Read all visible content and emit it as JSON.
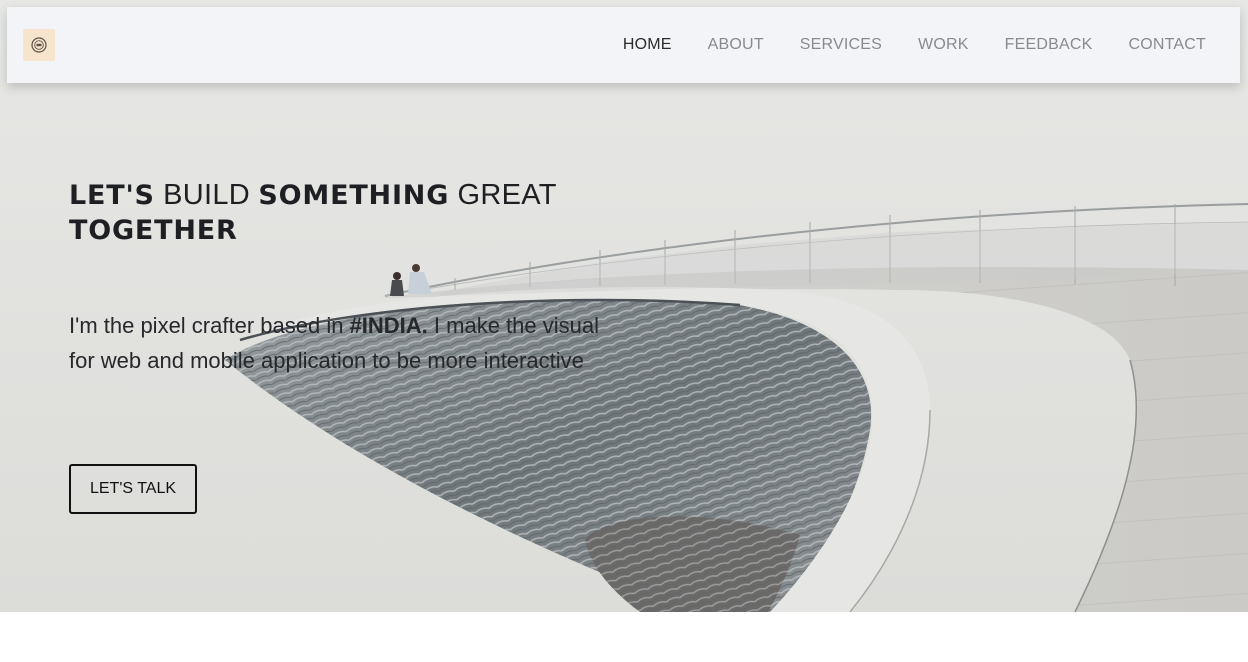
{
  "brand": {
    "logo_icon": "badge-logo-icon",
    "logo_bg": "#f6e4cc"
  },
  "nav": {
    "items": [
      {
        "label": "HOME",
        "active": true
      },
      {
        "label": "ABOUT",
        "active": false
      },
      {
        "label": "SERVICES",
        "active": false
      },
      {
        "label": "WORK",
        "active": false
      },
      {
        "label": "FEEDBACK",
        "active": false
      },
      {
        "label": "CONTACT",
        "active": false
      }
    ]
  },
  "hero": {
    "headline": {
      "w1": "LET'S",
      "w2": "BUILD",
      "w3": "SOMETHING",
      "w4": "GREAT",
      "w5": "TOGETHER"
    },
    "intro": {
      "part1": "I'm the pixel crafter based in ",
      "highlight": "#INDIA.",
      "part2": " I make the visual for web and mobile application to be more interactive"
    },
    "cta_label": "LET'S TALK",
    "background_image": "curved-architecture-building-photo"
  },
  "colors": {
    "navbar_bg": "#f3f4f8",
    "nav_active": "#2b2b2b",
    "nav_inactive": "#8a8a8e",
    "text_dark": "#1d1f22"
  }
}
